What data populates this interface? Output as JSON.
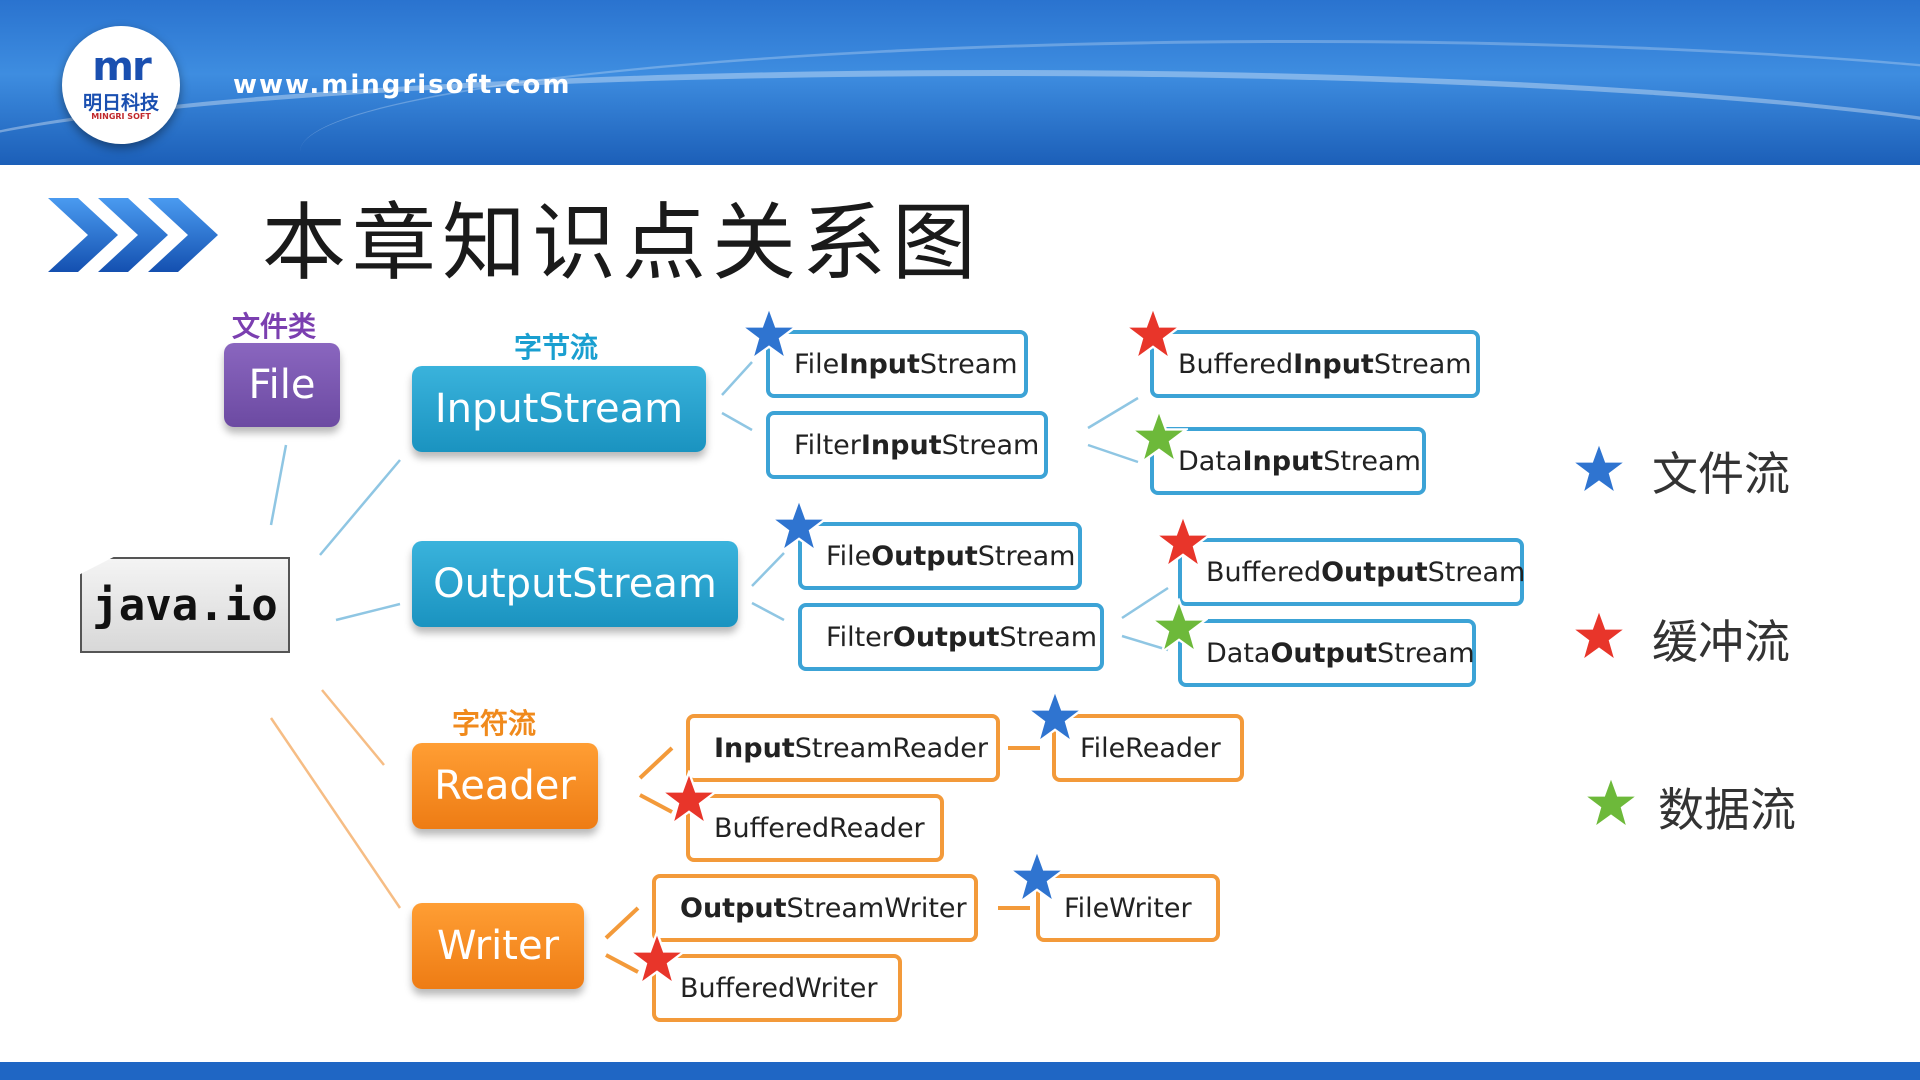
{
  "header": {
    "site_url": "www.mingrisoft.com",
    "logo": {
      "mark": "mr",
      "name_cn": "明日科技",
      "name_en": "MINGRI SOFT"
    }
  },
  "slide": {
    "title": "本章知识点关系图"
  },
  "root": {
    "label": "java.io"
  },
  "categories": {
    "file": "文件类",
    "byte_stream": "字节流",
    "char_stream": "字符流"
  },
  "main_nodes": {
    "file": "File",
    "input_stream": "InputStream",
    "output_stream": "OutputStream",
    "reader": "Reader",
    "writer": "Writer"
  },
  "classes": {
    "file_input_stream": {
      "pre": "File",
      "bold": "Input",
      "post": "Stream",
      "kind": "文件流"
    },
    "filter_input_stream": {
      "pre": "Filter",
      "bold": "Input",
      "post": "Stream",
      "kind": ""
    },
    "buffered_input_stream": {
      "pre": "Buffered",
      "bold": "Input",
      "post": "Stream",
      "kind": "缓冲流"
    },
    "data_input_stream": {
      "pre": "Data",
      "bold": "Input",
      "post": "Stream",
      "kind": "数据流"
    },
    "file_output_stream": {
      "pre": "File",
      "bold": "Output",
      "post": "Stream",
      "kind": "文件流"
    },
    "filter_output_stream": {
      "pre": "Filter",
      "bold": "Output",
      "post": "Stream",
      "kind": ""
    },
    "buffered_output_stream": {
      "pre": "Buffered",
      "bold": "Output",
      "post": "Stream",
      "kind": "缓冲流"
    },
    "data_output_stream": {
      "pre": "Data",
      "bold": "Output",
      "post": "Stream",
      "kind": "数据流"
    },
    "input_stream_reader": {
      "pre": "",
      "bold": "Input",
      "post": "StreamReader",
      "kind": ""
    },
    "file_reader": {
      "pre": "FileReader",
      "bold": "",
      "post": "",
      "kind": "文件流"
    },
    "buffered_reader": {
      "pre": "BufferedReader",
      "bold": "",
      "post": "",
      "kind": "缓冲流"
    },
    "output_stream_writer": {
      "pre": "",
      "bold": "Output",
      "post": "StreamWriter",
      "kind": ""
    },
    "file_writer": {
      "pre": "FileWriter",
      "bold": "",
      "post": "",
      "kind": "文件流"
    },
    "buffered_writer": {
      "pre": "BufferedWriter",
      "bold": "",
      "post": "",
      "kind": "缓冲流"
    }
  },
  "legend": [
    {
      "label": "文件流",
      "color": "#2f74d0"
    },
    {
      "label": "缓冲流",
      "color": "#e8352a"
    },
    {
      "label": "数据流",
      "color": "#6db93a"
    }
  ],
  "colors": {
    "byte_stream": "#1a9fd0",
    "char_stream": "#f08a1c",
    "file_class": "#7b3fb0",
    "header_blue": "#2a73cf"
  }
}
